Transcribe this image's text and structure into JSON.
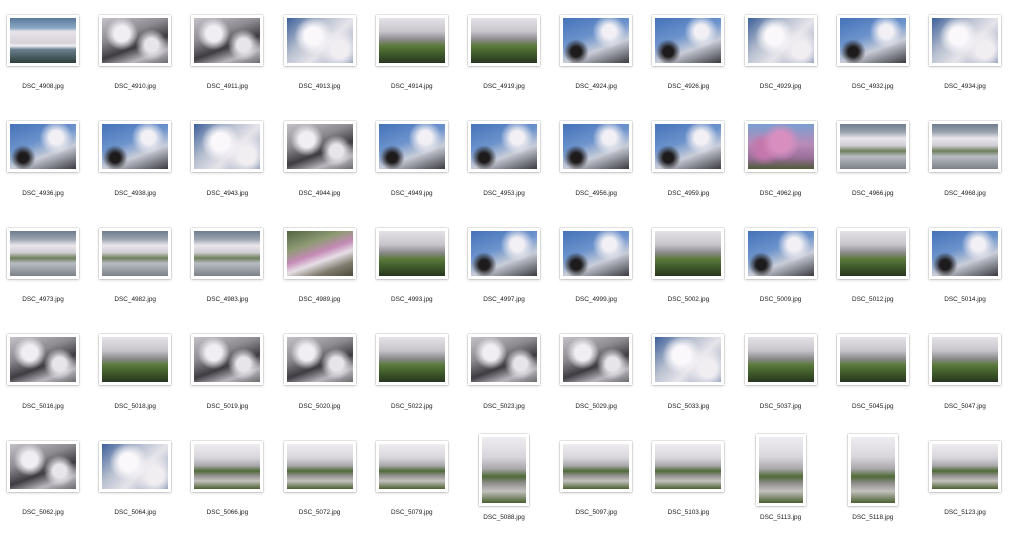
{
  "colors": {
    "background": "#ffffff",
    "label_text": "#1a1a1a"
  },
  "photos": [
    {
      "file": "DSC_4908.jpg",
      "orientation": "landscape",
      "scene": "lake-promenade"
    },
    {
      "file": "DSC_4910.jpg",
      "orientation": "landscape",
      "scene": "dense-canopy"
    },
    {
      "file": "DSC_4911.jpg",
      "orientation": "landscape",
      "scene": "dense-canopy"
    },
    {
      "file": "DSC_4913.jpg",
      "orientation": "landscape",
      "scene": "blossom-sky"
    },
    {
      "file": "DSC_4914.jpg",
      "orientation": "landscape",
      "scene": "avenue-lawn"
    },
    {
      "file": "DSC_4919.jpg",
      "orientation": "landscape",
      "scene": "avenue-lawn"
    },
    {
      "file": "DSC_4924.jpg",
      "orientation": "landscape",
      "scene": "branches-sky"
    },
    {
      "file": "DSC_4926.jpg",
      "orientation": "landscape",
      "scene": "branches-sky"
    },
    {
      "file": "DSC_4929.jpg",
      "orientation": "landscape",
      "scene": "blossom-sky"
    },
    {
      "file": "DSC_4932.jpg",
      "orientation": "landscape",
      "scene": "branches-sky"
    },
    {
      "file": "DSC_4934.jpg",
      "orientation": "landscape",
      "scene": "blossom-sky"
    },
    {
      "file": "DSC_4936.jpg",
      "orientation": "landscape",
      "scene": "branches-sky"
    },
    {
      "file": "DSC_4938.jpg",
      "orientation": "landscape",
      "scene": "branches-sky"
    },
    {
      "file": "DSC_4943.jpg",
      "orientation": "landscape",
      "scene": "blossom-sky"
    },
    {
      "file": "DSC_4944.jpg",
      "orientation": "landscape",
      "scene": "dense-canopy"
    },
    {
      "file": "DSC_4949.jpg",
      "orientation": "landscape",
      "scene": "branches-sky"
    },
    {
      "file": "DSC_4953.jpg",
      "orientation": "landscape",
      "scene": "branches-sky"
    },
    {
      "file": "DSC_4956.jpg",
      "orientation": "landscape",
      "scene": "branches-sky"
    },
    {
      "file": "DSC_4959.jpg",
      "orientation": "landscape",
      "scene": "branches-sky"
    },
    {
      "file": "DSC_4962.jpg",
      "orientation": "landscape",
      "scene": "pink-weeping"
    },
    {
      "file": "DSC_4966.jpg",
      "orientation": "landscape",
      "scene": "aerial-parking"
    },
    {
      "file": "DSC_4968.jpg",
      "orientation": "landscape",
      "scene": "aerial-parking"
    },
    {
      "file": "DSC_4973.jpg",
      "orientation": "landscape",
      "scene": "aerial-parking"
    },
    {
      "file": "DSC_4982.jpg",
      "orientation": "landscape",
      "scene": "aerial-parking"
    },
    {
      "file": "DSC_4983.jpg",
      "orientation": "landscape",
      "scene": "aerial-parking"
    },
    {
      "file": "DSC_4989.jpg",
      "orientation": "landscape",
      "scene": "hillside-pink"
    },
    {
      "file": "DSC_4993.jpg",
      "orientation": "landscape",
      "scene": "avenue-lawn"
    },
    {
      "file": "DSC_4997.jpg",
      "orientation": "landscape",
      "scene": "branches-sky"
    },
    {
      "file": "DSC_4999.jpg",
      "orientation": "landscape",
      "scene": "branches-sky"
    },
    {
      "file": "DSC_5002.jpg",
      "orientation": "landscape",
      "scene": "avenue-lawn"
    },
    {
      "file": "DSC_5009.jpg",
      "orientation": "landscape",
      "scene": "branches-sky"
    },
    {
      "file": "DSC_5012.jpg",
      "orientation": "landscape",
      "scene": "avenue-lawn"
    },
    {
      "file": "DSC_5014.jpg",
      "orientation": "landscape",
      "scene": "branches-sky"
    },
    {
      "file": "DSC_5016.jpg",
      "orientation": "landscape",
      "scene": "dense-canopy"
    },
    {
      "file": "DSC_5018.jpg",
      "orientation": "landscape",
      "scene": "avenue-lawn"
    },
    {
      "file": "DSC_5019.jpg",
      "orientation": "landscape",
      "scene": "dense-canopy"
    },
    {
      "file": "DSC_5020.jpg",
      "orientation": "landscape",
      "scene": "dense-canopy"
    },
    {
      "file": "DSC_5022.jpg",
      "orientation": "landscape",
      "scene": "avenue-lawn"
    },
    {
      "file": "DSC_5023.jpg",
      "orientation": "landscape",
      "scene": "dense-canopy"
    },
    {
      "file": "DSC_5029.jpg",
      "orientation": "landscape",
      "scene": "dense-canopy"
    },
    {
      "file": "DSC_5033.jpg",
      "orientation": "landscape",
      "scene": "blossom-sky"
    },
    {
      "file": "DSC_5037.jpg",
      "orientation": "landscape",
      "scene": "avenue-lawn"
    },
    {
      "file": "DSC_5045.jpg",
      "orientation": "landscape",
      "scene": "avenue-lawn"
    },
    {
      "file": "DSC_5047.jpg",
      "orientation": "landscape",
      "scene": "avenue-lawn"
    },
    {
      "file": "DSC_5062.jpg",
      "orientation": "landscape",
      "scene": "dense-canopy"
    },
    {
      "file": "DSC_5064.jpg",
      "orientation": "landscape",
      "scene": "blossom-sky"
    },
    {
      "file": "DSC_5066.jpg",
      "orientation": "landscape",
      "scene": "road-avenue"
    },
    {
      "file": "DSC_5072.jpg",
      "orientation": "landscape",
      "scene": "road-avenue"
    },
    {
      "file": "DSC_5079.jpg",
      "orientation": "landscape",
      "scene": "road-avenue"
    },
    {
      "file": "DSC_5088.jpg",
      "orientation": "portrait",
      "scene": "road-avenue"
    },
    {
      "file": "DSC_5097.jpg",
      "orientation": "landscape",
      "scene": "road-avenue"
    },
    {
      "file": "DSC_5103.jpg",
      "orientation": "landscape",
      "scene": "road-avenue"
    },
    {
      "file": "DSC_5113.jpg",
      "orientation": "portrait",
      "scene": "road-avenue"
    },
    {
      "file": "DSC_5118.jpg",
      "orientation": "portrait",
      "scene": "road-avenue"
    },
    {
      "file": "DSC_5123.jpg",
      "orientation": "landscape",
      "scene": "road-avenue"
    }
  ]
}
